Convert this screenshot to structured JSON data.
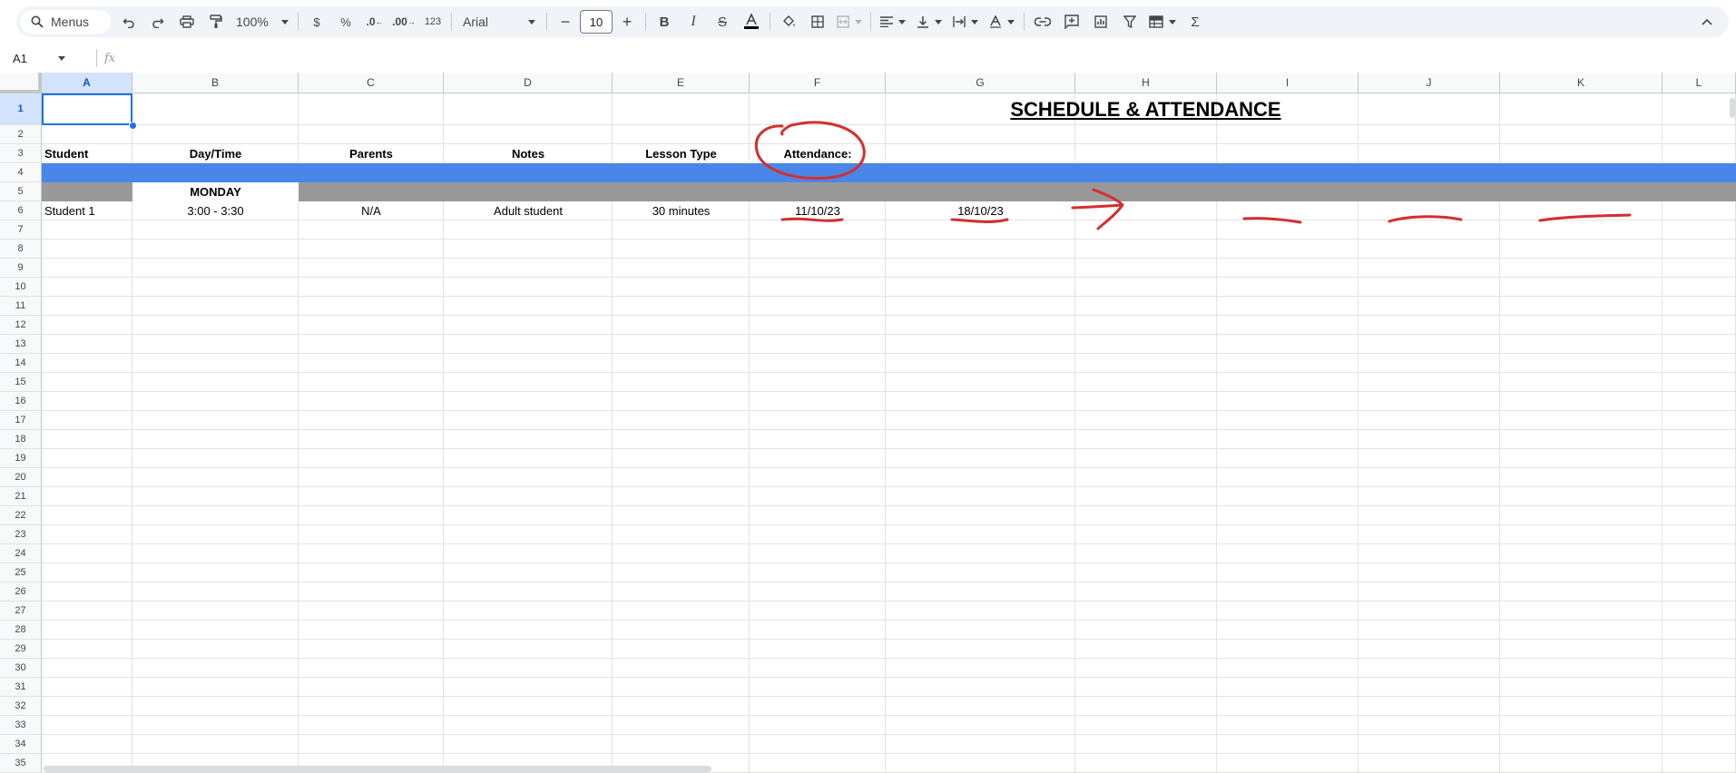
{
  "toolbar": {
    "menus_label": "Menus",
    "zoom": "100%",
    "currency_label": "$",
    "percent_label": "%",
    "dec_decrease_label": ".0",
    "dec_increase_label": ".00",
    "format_label": "123",
    "font": "Arial",
    "font_size": "10"
  },
  "formula_bar": {
    "cell_ref": "A1",
    "fx_label": "fx"
  },
  "columns": [
    "A",
    "B",
    "C",
    "D",
    "E",
    "F",
    "G",
    "H",
    "I",
    "J",
    "K",
    "L"
  ],
  "rows": [
    "1",
    "2",
    "3",
    "4",
    "5",
    "6",
    "7",
    "8",
    "9",
    "10",
    "11",
    "12",
    "13",
    "14",
    "15",
    "16",
    "17",
    "18",
    "19",
    "20",
    "21",
    "22",
    "23",
    "24",
    "25",
    "26",
    "27",
    "28",
    "29",
    "30",
    "31",
    "32",
    "33",
    "34",
    "35"
  ],
  "sheet": {
    "title": "SCHEDULE & ATTENDANCE",
    "headers": {
      "student": "Student",
      "day_time": "Day/Time",
      "parents": "Parents",
      "notes": "Notes",
      "lesson_type": "Lesson Type",
      "attendance": "Attendance:"
    },
    "day_label": "MONDAY",
    "student_row": {
      "student": "Student 1",
      "day_time": "3:00 - 3:30",
      "parents": "N/A",
      "notes": "Adult student",
      "lesson_type": "30 minutes",
      "date1": "11/10/23",
      "date2": "18/10/23"
    }
  },
  "colors": {
    "blue_band": "#4a86e8",
    "gray_band": "#999999",
    "annotation_red": "#d32f2f",
    "selection": "#1a73e8"
  }
}
